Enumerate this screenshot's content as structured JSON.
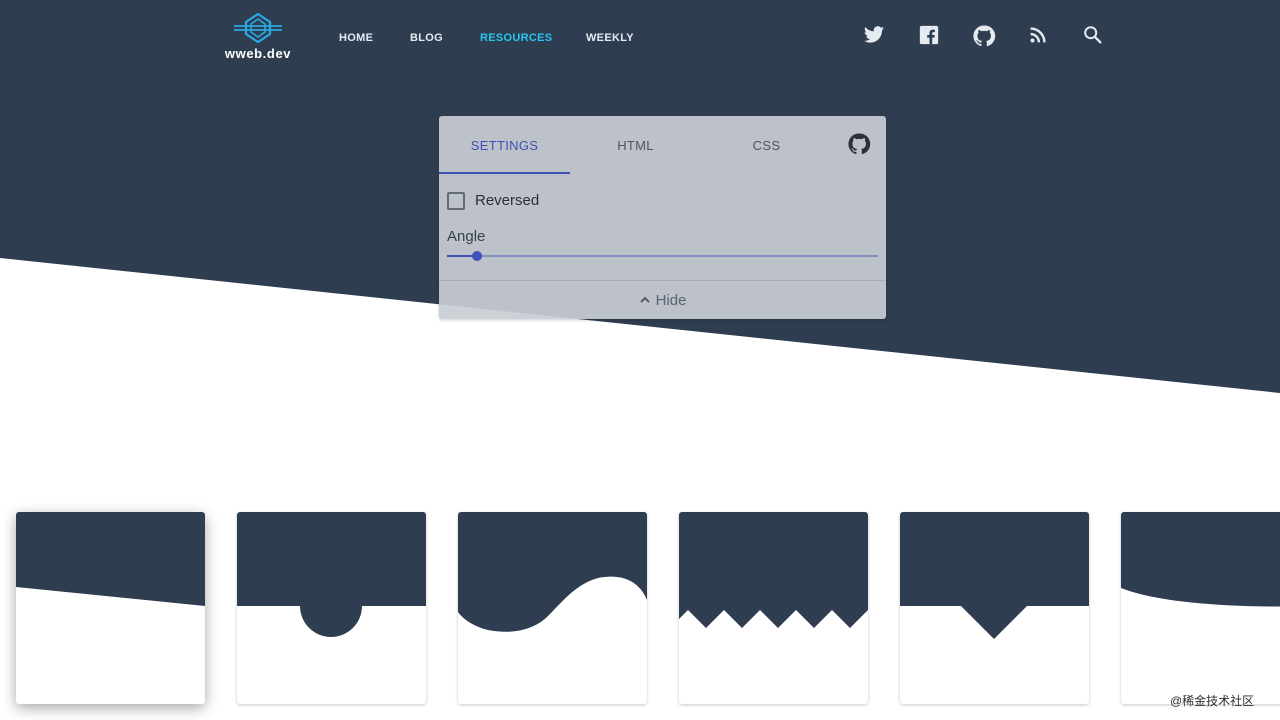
{
  "header": {
    "logo_text": "wweb.dev",
    "nav": [
      {
        "label": "HOME",
        "active": false
      },
      {
        "label": "BLOG",
        "active": false
      },
      {
        "label": "RESOURCES",
        "active": true
      },
      {
        "label": "WEEKLY",
        "active": false
      }
    ],
    "social_icons": [
      "twitter-icon",
      "facebook-icon",
      "github-icon",
      "rss-icon",
      "search-icon"
    ]
  },
  "panel": {
    "tabs": [
      {
        "label": "SETTINGS",
        "active": true
      },
      {
        "label": "HTML",
        "active": false
      },
      {
        "label": "CSS",
        "active": false
      }
    ],
    "reversed_label": "Reversed",
    "reversed_checked": false,
    "angle_label": "Angle",
    "angle_value_fraction": 0.07,
    "hide_label": "Hide",
    "hide_icon": "chevron-up-icon"
  },
  "cards": [
    {
      "shape": "tilt",
      "selected": true
    },
    {
      "shape": "half-circle",
      "selected": false
    },
    {
      "shape": "wave",
      "selected": false
    },
    {
      "shape": "zigzag",
      "selected": false
    },
    {
      "shape": "triangle",
      "selected": false
    },
    {
      "shape": "curve",
      "selected": false
    }
  ],
  "colors": {
    "dark": "#2e3d50",
    "accent": "#26c6f0",
    "primary": "#3f51b5"
  },
  "watermark": "@稀金技术社区"
}
